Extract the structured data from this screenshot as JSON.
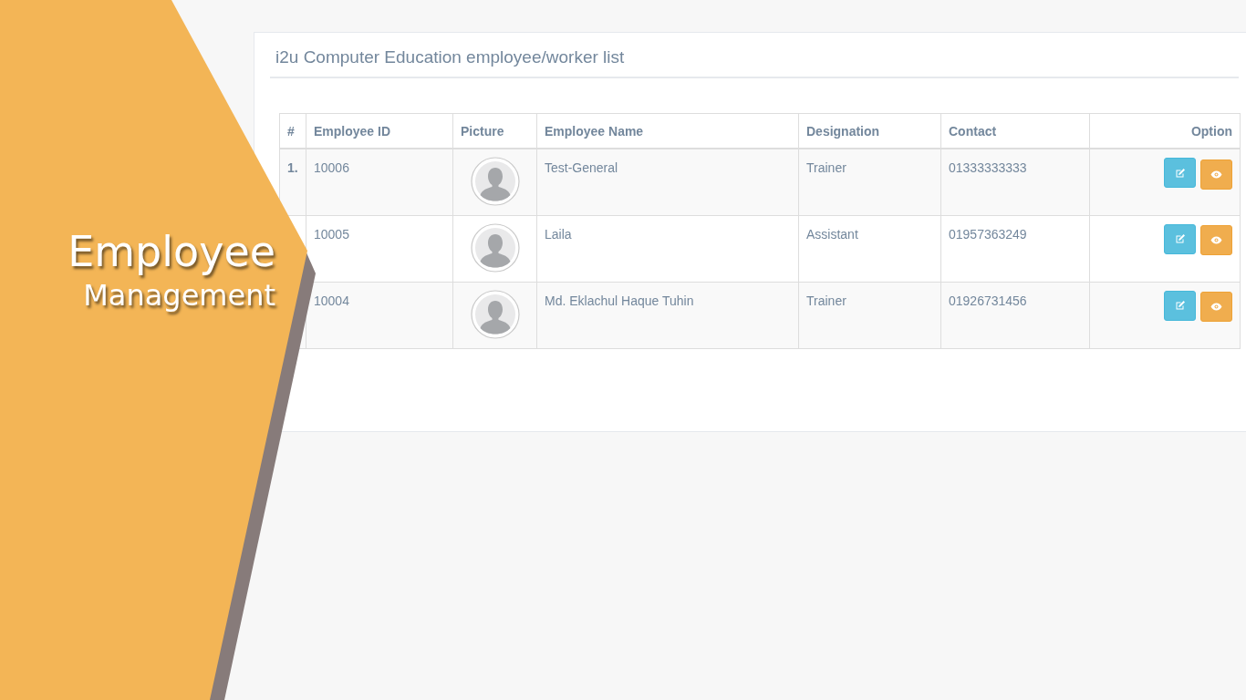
{
  "panel": {
    "title": "i2u Computer Education employee/worker list"
  },
  "table": {
    "columns": [
      "#",
      "Employee ID",
      "Picture",
      "Employee Name",
      "Designation",
      "Contact",
      "Option"
    ],
    "rows": [
      {
        "number": "1.",
        "employee_id": "10006",
        "name": "Test-General",
        "designation": "Trainer",
        "contact": "01333333333"
      },
      {
        "employee_id": "10005",
        "name": "Laila",
        "designation": "Assistant",
        "contact": "01957363249"
      },
      {
        "employee_id": "10004",
        "name": "Md. Eklachul Haque Tuhin",
        "designation": "Trainer",
        "contact": "01926731456"
      }
    ]
  },
  "banner": {
    "title": "Employee",
    "subtitle": "Management"
  }
}
